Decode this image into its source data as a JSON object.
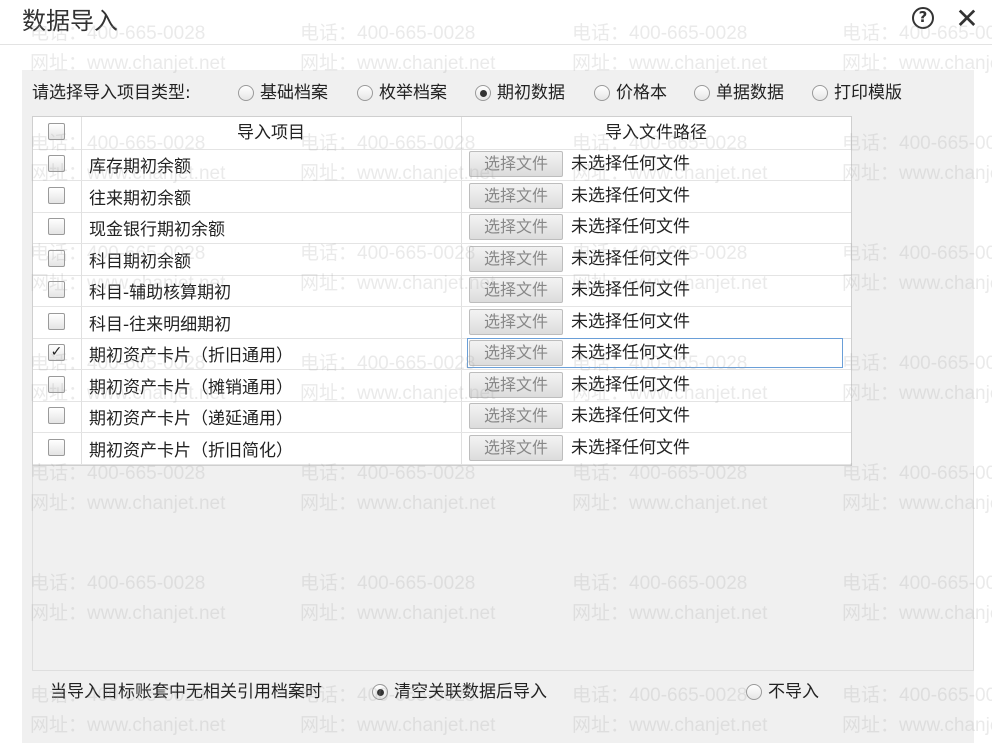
{
  "window": {
    "title": "数据导入",
    "help_icon": "help-circle-icon",
    "help_glyph": "?",
    "close_icon": "close-icon",
    "close_glyph": "✕"
  },
  "import_type": {
    "label": "请选择导入项目类型:",
    "options": [
      {
        "label": "基础档案",
        "selected": false
      },
      {
        "label": "枚举档案",
        "selected": false
      },
      {
        "label": "期初数据",
        "selected": true
      },
      {
        "label": "价格本",
        "selected": false
      },
      {
        "label": "单据数据",
        "selected": false
      },
      {
        "label": "打印模版",
        "selected": false
      }
    ]
  },
  "table": {
    "columns": [
      "导入项目",
      "导入文件路径"
    ],
    "choose_file_label": "选择文件",
    "rows": [
      {
        "item": "库存期初余额",
        "checked": false,
        "file_status": "未选择任何文件"
      },
      {
        "item": "往来期初余额",
        "checked": false,
        "file_status": "未选择任何文件"
      },
      {
        "item": "现金银行期初余额",
        "checked": false,
        "file_status": "未选择任何文件"
      },
      {
        "item": "科目期初余额",
        "checked": false,
        "file_status": "未选择任何文件"
      },
      {
        "item": "科目-辅助核算期初",
        "checked": false,
        "file_status": "未选择任何文件"
      },
      {
        "item": "科目-往来明细期初",
        "checked": false,
        "file_status": "未选择任何文件"
      },
      {
        "item": "期初资产卡片（折旧通用）",
        "checked": true,
        "file_status": "未选择任何文件"
      },
      {
        "item": "期初资产卡片（摊销通用）",
        "checked": false,
        "file_status": "未选择任何文件"
      },
      {
        "item": "期初资产卡片（递延通用）",
        "checked": false,
        "file_status": "未选择任何文件"
      },
      {
        "item": "期初资产卡片（折旧简化）",
        "checked": false,
        "file_status": "未选择任何文件"
      }
    ]
  },
  "bottom": {
    "label": "当导入目标账套中无相关引用档案时",
    "options": [
      {
        "label": "清空关联数据后导入",
        "selected": true
      },
      {
        "label": "不导入",
        "selected": false
      }
    ]
  },
  "watermark": {
    "phone": "电话：400-665-0028",
    "site": "网址：www.chanjet.net"
  }
}
